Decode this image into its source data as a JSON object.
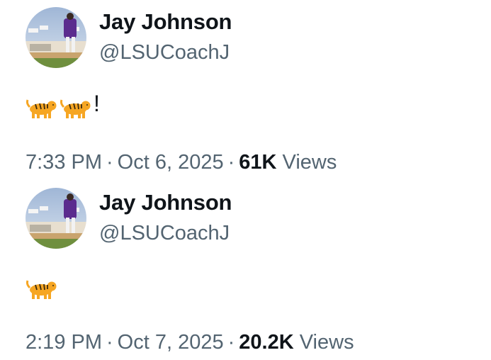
{
  "tweets": [
    {
      "author": {
        "name": "Jay Johnson",
        "handle": "@LSUCoachJ"
      },
      "text_icons": [
        "tiger-emoji",
        "tiger-emoji"
      ],
      "text_suffix": "!",
      "time": "7:33 PM",
      "date": "Oct 6, 2025",
      "separator": "·",
      "views_count": "61K",
      "views_label": "Views"
    },
    {
      "author": {
        "name": "Jay Johnson",
        "handle": "@LSUCoachJ"
      },
      "text_icons": [
        "tiger-emoji"
      ],
      "text_suffix": "",
      "time": "2:19 PM",
      "date": "Oct 7, 2025",
      "separator": "·",
      "views_count": "20.2K",
      "views_label": "Views"
    }
  ],
  "colors": {
    "primary_text": "#0f1419",
    "secondary_text": "#536471",
    "background": "#ffffff"
  }
}
